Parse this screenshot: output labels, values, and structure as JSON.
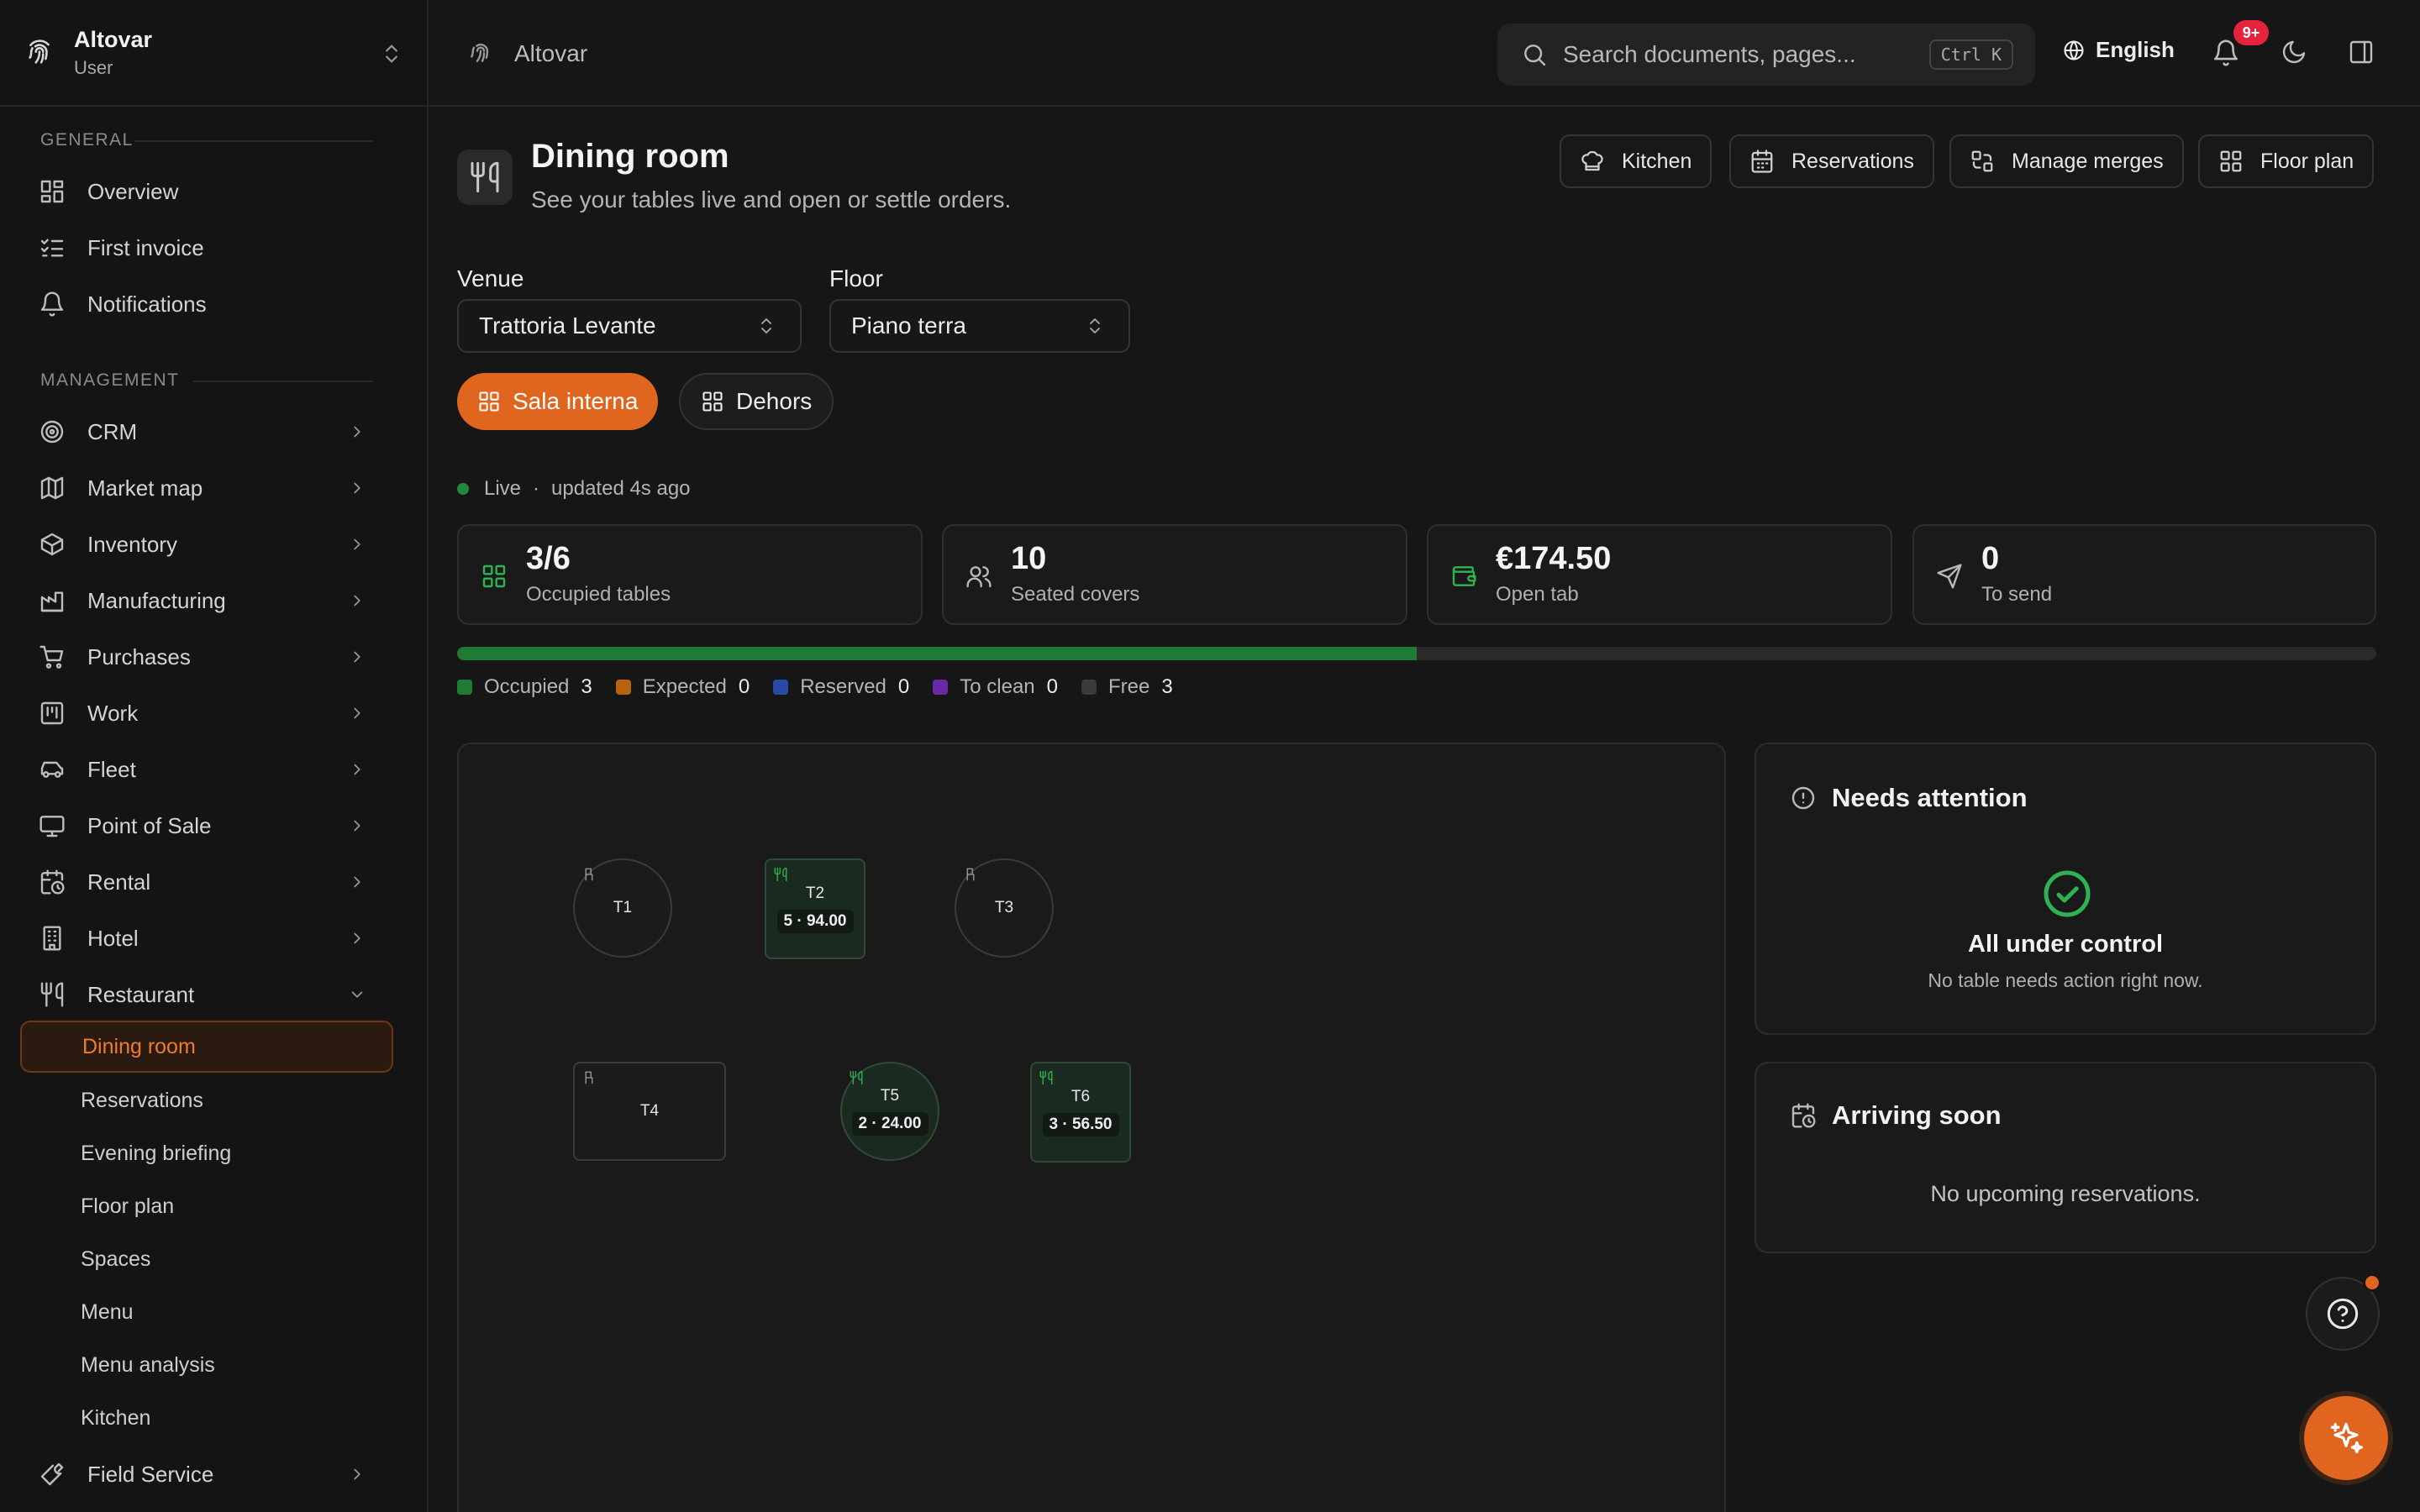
{
  "org": {
    "name": "Altovar",
    "role": "User"
  },
  "sidebar": {
    "general_label": "GENERAL",
    "general_items": [
      {
        "label": "Overview",
        "icon": "grid-icon"
      },
      {
        "label": "First invoice",
        "icon": "checklist-icon"
      },
      {
        "label": "Notifications",
        "icon": "bell-icon"
      }
    ],
    "management_label": "MANAGEMENT",
    "management_items": [
      {
        "label": "CRM",
        "icon": "target-icon"
      },
      {
        "label": "Market map",
        "icon": "map-icon"
      },
      {
        "label": "Inventory",
        "icon": "box-icon"
      },
      {
        "label": "Manufacturing",
        "icon": "factory-icon"
      },
      {
        "label": "Purchases",
        "icon": "cart-icon"
      },
      {
        "label": "Work",
        "icon": "kanban-icon"
      },
      {
        "label": "Fleet",
        "icon": "car-icon"
      },
      {
        "label": "Point of Sale",
        "icon": "monitor-icon"
      },
      {
        "label": "Rental",
        "icon": "calendar-clock-icon"
      },
      {
        "label": "Hotel",
        "icon": "building-icon"
      },
      {
        "label": "Restaurant",
        "icon": "utensils-icon"
      }
    ],
    "restaurant_sub": [
      "Dining room",
      "Reservations",
      "Evening briefing",
      "Floor plan",
      "Spaces",
      "Menu",
      "Menu analysis",
      "Kitchen"
    ],
    "field_service": "Field Service"
  },
  "topbar": {
    "breadcrumb": "Altovar",
    "search_placeholder": "Search documents, pages...",
    "search_shortcut": "Ctrl K",
    "language": "English",
    "notif_badge": "9+"
  },
  "page": {
    "title": "Dining room",
    "subtitle": "See your tables live and open or settle orders.",
    "actions": [
      "Kitchen",
      "Reservations",
      "Manage merges",
      "Floor plan"
    ]
  },
  "filters": {
    "venue_label": "Venue",
    "venue_value": "Trattoria Levante",
    "floor_label": "Floor",
    "floor_value": "Piano terra",
    "rooms": [
      "Sala interna",
      "Dehors"
    ],
    "active_room": "Sala interna"
  },
  "status": {
    "live": "Live",
    "separator": "·",
    "updated": "updated 4s ago"
  },
  "stats": [
    {
      "value": "3/6",
      "label": "Occupied tables",
      "icon": "grid-icon",
      "color": "#2fb352"
    },
    {
      "value": "10",
      "label": "Seated covers",
      "icon": "users-icon",
      "color": "#b8b8b8"
    },
    {
      "value": "€174.50",
      "label": "Open tab",
      "icon": "wallet-icon",
      "color": "#2fb352"
    },
    {
      "value": "0",
      "label": "To send",
      "icon": "send-icon",
      "color": "#b8b8b8"
    }
  ],
  "occupancy_fraction": 0.5,
  "legend": [
    {
      "label": "Occupied",
      "count": "3",
      "color": "#1f7a33"
    },
    {
      "label": "Expected",
      "count": "0",
      "color": "#b8620f"
    },
    {
      "label": "Reserved",
      "count": "0",
      "color": "#2a4aa8"
    },
    {
      "label": "To clean",
      "count": "0",
      "color": "#6a2aa8"
    },
    {
      "label": "Free",
      "count": "3",
      "color": "#3a3a3a"
    }
  ],
  "tables": [
    {
      "name": "T1",
      "shape": "round",
      "status": "free",
      "info": ""
    },
    {
      "name": "T2",
      "shape": "square",
      "status": "occupied",
      "info": "5 · 94.00"
    },
    {
      "name": "T3",
      "shape": "round",
      "status": "free",
      "info": ""
    },
    {
      "name": "T4",
      "shape": "square",
      "status": "free",
      "info": ""
    },
    {
      "name": "T5",
      "shape": "round",
      "status": "occupied",
      "info": "2 · 24.00"
    },
    {
      "name": "T6",
      "shape": "square",
      "status": "occupied",
      "info": "3 · 56.50"
    }
  ],
  "attention": {
    "title": "Needs attention",
    "ok_title": "All under control",
    "ok_text": "No table needs action right now."
  },
  "arriving": {
    "title": "Arriving soon",
    "empty": "No upcoming reservations."
  },
  "colors": {
    "accent": "#e0651e",
    "success": "#2fb352",
    "background": "#161616"
  }
}
